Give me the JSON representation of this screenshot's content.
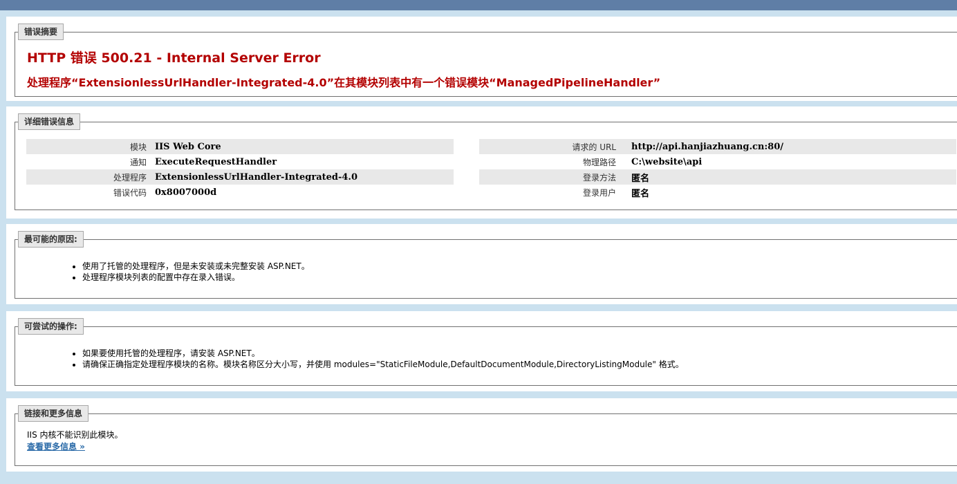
{
  "summary": {
    "legend": "错误摘要",
    "title": "HTTP 错误 500.21 - Internal Server Error",
    "subtitle": "处理程序“ExtensionlessUrlHandler-Integrated-4.0”在其模块列表中有一个错误模块“ManagedPipelineHandler”"
  },
  "details": {
    "legend": "详细错误信息",
    "left": [
      {
        "key": "模块",
        "value": "IIS Web Core"
      },
      {
        "key": "通知",
        "value": "ExecuteRequestHandler"
      },
      {
        "key": "处理程序",
        "value": "ExtensionlessUrlHandler-Integrated-4.0"
      },
      {
        "key": "错误代码",
        "value": "0x8007000d"
      }
    ],
    "right": [
      {
        "key": "请求的 URL",
        "value": "http://api.hanjiazhuang.cn:80/"
      },
      {
        "key": "物理路径",
        "value": "C:\\website\\api"
      },
      {
        "key": "登录方法",
        "value": "匿名"
      },
      {
        "key": "登录用户",
        "value": "匿名"
      }
    ]
  },
  "causes": {
    "legend": "最可能的原因:",
    "items": [
      "使用了托管的处理程序，但是未安装或未完整安装 ASP.NET。",
      "处理程序模块列表的配置中存在录入错误。"
    ]
  },
  "actions": {
    "legend": "可尝试的操作:",
    "items": [
      "如果要使用托管的处理程序，请安装 ASP.NET。",
      "请确保正确指定处理程序模块的名称。模块名称区分大小写，并使用 modules=\"StaticFileModule,DefaultDocumentModule,DirectoryListingModule\" 格式。"
    ]
  },
  "links": {
    "legend": "链接和更多信息",
    "text": "IIS 内核不能识别此模块。",
    "more_link": "查看更多信息 »"
  },
  "colors": {
    "error_red": "#b30000",
    "header_bar": "#5f7ea6",
    "background": "#cbe1ef",
    "link": "#2a6aa8"
  }
}
